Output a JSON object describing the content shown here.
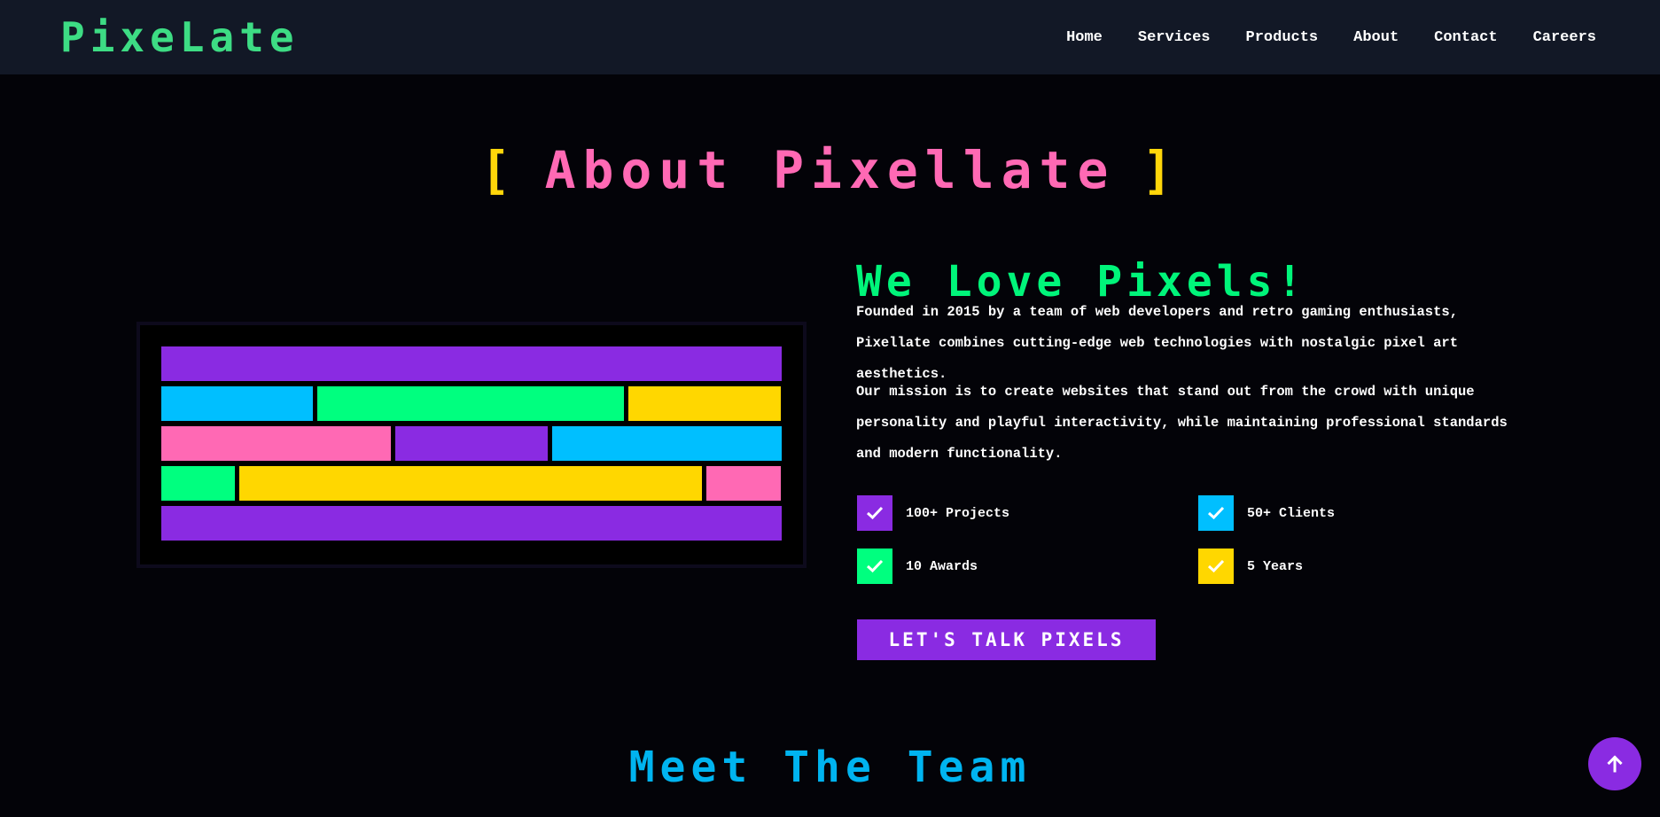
{
  "header": {
    "logo": "PixeLate",
    "nav": [
      "Home",
      "Services",
      "Products",
      "About",
      "Contact",
      "Careers"
    ]
  },
  "section": {
    "bracket_left": "[",
    "title": "About Pixellate",
    "bracket_right": "]"
  },
  "pixel_art": {
    "rows": [
      [
        "#8a2be2"
      ],
      [
        "#00bfff",
        "#00ff7f",
        "#ffd700"
      ],
      [
        "#ff69b4",
        "#8a2be2",
        "#00bfff"
      ],
      [
        "#00ff7f",
        "#ffd700",
        "#ff69b4"
      ],
      [
        "#8a2be2"
      ]
    ]
  },
  "about": {
    "heading": "We Love Pixels!",
    "paragraph1": "Founded in 2015 by a team of web developers and retro gaming enthusiasts, Pixellate combines cutting-edge web technologies with nostalgic pixel art aesthetics.",
    "paragraph2": "Our mission is to create websites that stand out from the crowd with unique personality and playful interactivity, while maintaining professional standards and modern functionality.",
    "stats": [
      {
        "label": "100+ Projects",
        "color": "#8a2be2",
        "icon": "check-icon"
      },
      {
        "label": "50+ Clients",
        "color": "#00bfff",
        "icon": "check-icon"
      },
      {
        "label": "10 Awards",
        "color": "#00ff7f",
        "icon": "check-icon"
      },
      {
        "label": "5 Years",
        "color": "#ffd700",
        "icon": "check-icon"
      }
    ],
    "cta_label": "LET'S TALK PIXELS"
  },
  "team": {
    "title": "Meet The Team"
  },
  "scroll_top": {
    "icon": "arrow-up-icon",
    "color": "#8a2be2"
  },
  "colors": {
    "logo": "#3ddc84",
    "title": "#ff69b4",
    "bracket": "#ffd60a",
    "heading": "#00f57a",
    "team_title": "#00b4f0",
    "header_bg": "#121826",
    "page_bg": "#030308"
  }
}
